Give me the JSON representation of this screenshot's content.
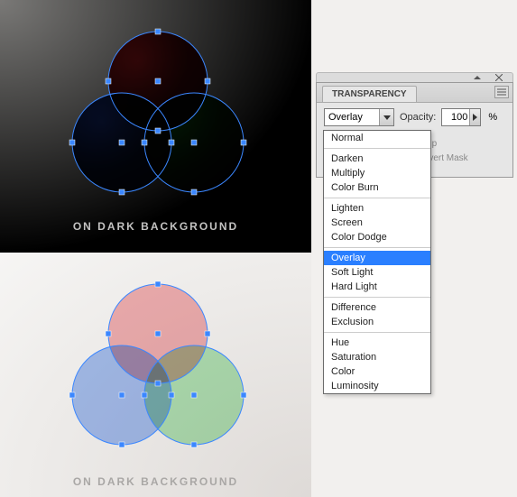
{
  "stages": {
    "dark_caption": "ON DARK BACKGROUND",
    "light_caption": "ON DARK BACKGROUND"
  },
  "venn_dark": {
    "circles": [
      {
        "color": "#a00c10",
        "name": "red-circle"
      },
      {
        "color": "#0a2a82",
        "name": "blue-circle"
      },
      {
        "color": "#0a7d12",
        "name": "green-circle"
      }
    ]
  },
  "venn_light": {
    "circles": [
      {
        "color": "#f6b4b7",
        "name": "red-circle"
      },
      {
        "color": "#a9c3f6",
        "name": "blue-circle"
      },
      {
        "color": "#b6e9bb",
        "name": "green-circle"
      }
    ]
  },
  "panel": {
    "tab": "TRANSPARENCY",
    "blend_label": "Overlay",
    "opacity_label": "Opacity:",
    "opacity_value": "100",
    "opacity_unit": "%",
    "clip_label": "Clip",
    "invert_label": "Invert Mask"
  },
  "blend_modes": {
    "groups": [
      [
        "Normal"
      ],
      [
        "Darken",
        "Multiply",
        "Color Burn"
      ],
      [
        "Lighten",
        "Screen",
        "Color Dodge"
      ],
      [
        "Overlay",
        "Soft Light",
        "Hard Light"
      ],
      [
        "Difference",
        "Exclusion"
      ],
      [
        "Hue",
        "Saturation",
        "Color",
        "Luminosity"
      ]
    ],
    "selected": "Overlay"
  }
}
